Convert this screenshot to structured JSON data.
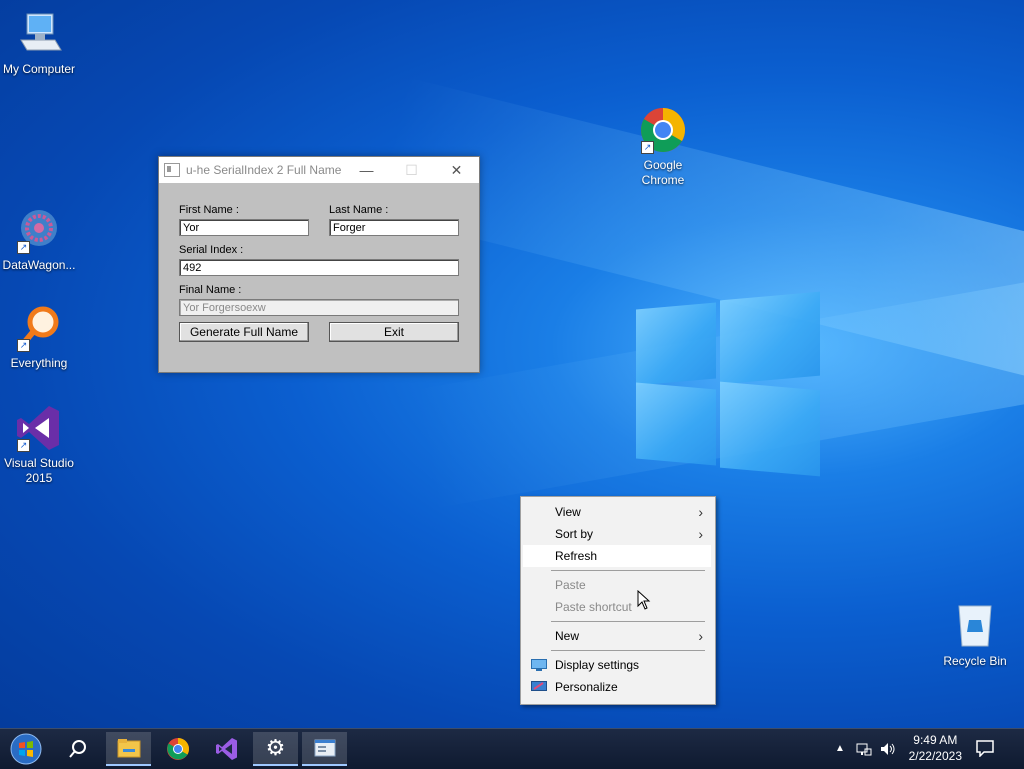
{
  "desktop": {
    "icons": [
      {
        "label": "My Computer"
      },
      {
        "label": "DataWagon..."
      },
      {
        "label": "Everything"
      },
      {
        "label": "Visual Studio 2015"
      },
      {
        "label": "Google Chrome"
      },
      {
        "label": "Recycle Bin"
      }
    ]
  },
  "dialog": {
    "title": "u-he SerialIndex 2 Full Name",
    "first_name_label": "First Name :",
    "first_name_value": "Yor",
    "last_name_label": "Last Name :",
    "last_name_value": "Forger",
    "serial_index_label": "Serial Index :",
    "serial_index_value": "492",
    "final_name_label": "Final Name :",
    "final_name_value": "Yor Forgersoexw",
    "generate_button": "Generate Full Name",
    "exit_button": "Exit"
  },
  "context_menu": {
    "items": [
      {
        "label": "View",
        "submenu": true
      },
      {
        "label": "Sort by",
        "submenu": true
      },
      {
        "label": "Refresh"
      },
      {
        "label": "Paste",
        "disabled": true
      },
      {
        "label": "Paste shortcut",
        "disabled": true
      },
      {
        "label": "New",
        "submenu": true
      },
      {
        "label": "Display settings"
      },
      {
        "label": "Personalize"
      }
    ]
  },
  "taskbar": {
    "time": "9:49 AM",
    "date": "2/22/2023",
    "apps": [
      "start-orb",
      "search",
      "file-explorer",
      "chrome",
      "visual-studio",
      "settings",
      "app-window"
    ]
  },
  "colors": {
    "desktop_accent": "#0b5fd0",
    "taskbar": "#1d2a44"
  }
}
